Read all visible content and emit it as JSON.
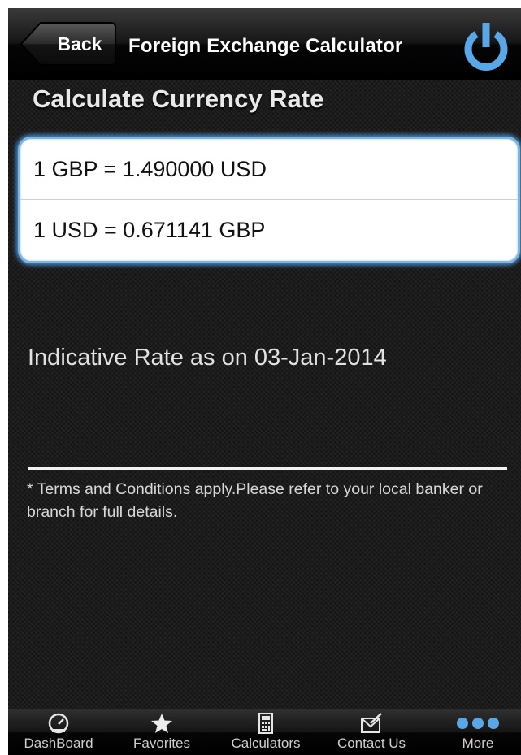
{
  "navbar": {
    "back_label": "Back",
    "title": "Foreign Exchange Calculator",
    "power_icon": "power-icon"
  },
  "main": {
    "section_title": "Calculate Currency Rate",
    "rates": [
      "1 GBP = 1.490000 USD",
      "1 USD = 0.671141 GBP"
    ],
    "indicative_text": "Indicative Rate as on 03-Jan-2014",
    "terms_text": "* Terms and Conditions apply.Please refer to your local banker or branch for full details."
  },
  "tabbar": {
    "items": [
      {
        "label": "DashBoard",
        "icon": "gauge-icon"
      },
      {
        "label": "Favorites",
        "icon": "star-icon"
      },
      {
        "label": "Calculators",
        "icon": "calculator-icon"
      },
      {
        "label": "Contact Us",
        "icon": "envelope-icon"
      },
      {
        "label": "More",
        "icon": "more-dots-icon"
      }
    ]
  },
  "colors": {
    "accent_blue": "#4d95d6",
    "power_icon_color": "#5aa7e8",
    "background": "#1b1b1b"
  }
}
